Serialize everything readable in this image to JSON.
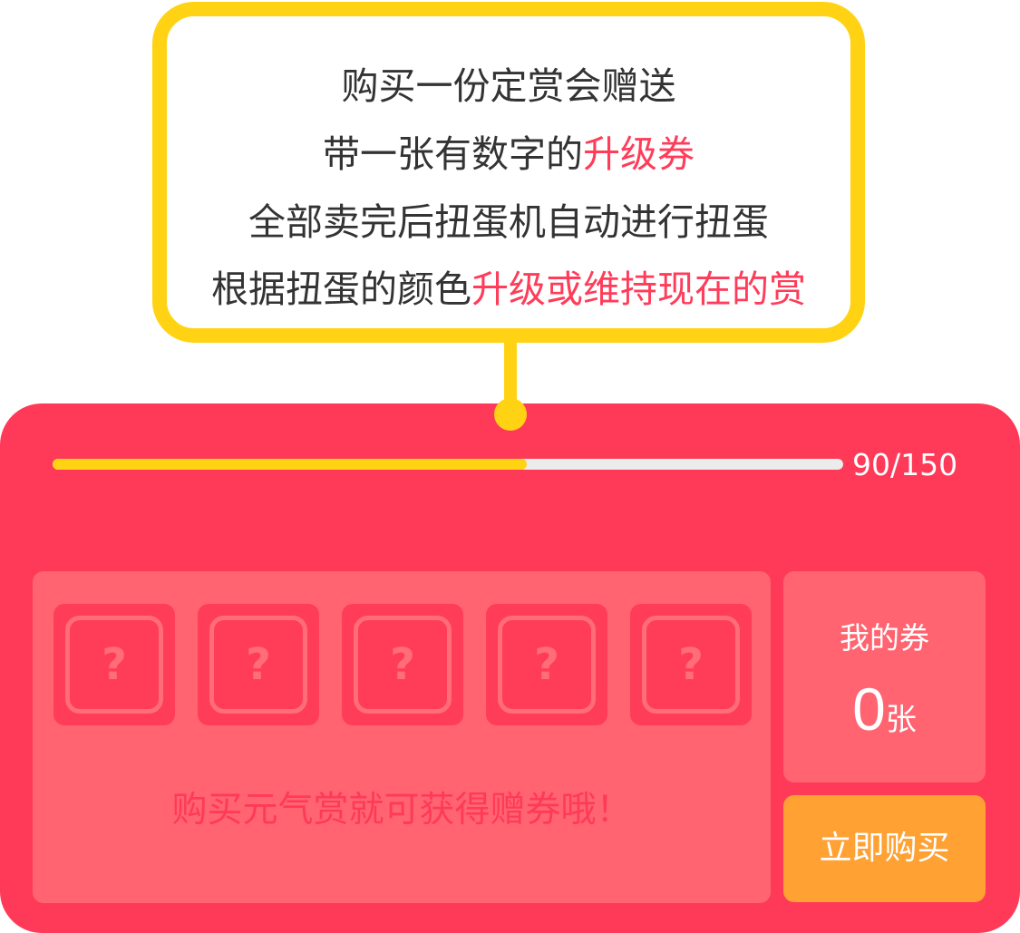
{
  "bubble": {
    "lines": [
      {
        "plain": "购买一份定赏会赠送",
        "highlight": ""
      },
      {
        "plain": "带一张有数字的",
        "highlight": "升级券"
      },
      {
        "plain": "全部卖完后扭蛋机自动进行扭蛋",
        "highlight": ""
      },
      {
        "plain": "根据扭蛋的颜色",
        "highlight": "升级或维持现在的赏"
      }
    ]
  },
  "progress": {
    "text": "90/150",
    "current": 90,
    "total": 150
  },
  "slots": [
    {
      "symbol": "?"
    },
    {
      "symbol": "?"
    },
    {
      "symbol": "?"
    },
    {
      "symbol": "?"
    },
    {
      "symbol": "?"
    }
  ],
  "panel": {
    "hint": "购买元气赏就可获得赠券哦！"
  },
  "coupon": {
    "label": "我的券",
    "count": "0",
    "unit": "张"
  },
  "buy_button": {
    "label": "立即购买"
  },
  "colors": {
    "card": "#ff3a59",
    "panel": "#ff6470",
    "accent_yellow": "#ffd314",
    "highlight_text": "#ff3c5a",
    "button": "#ffa133"
  }
}
